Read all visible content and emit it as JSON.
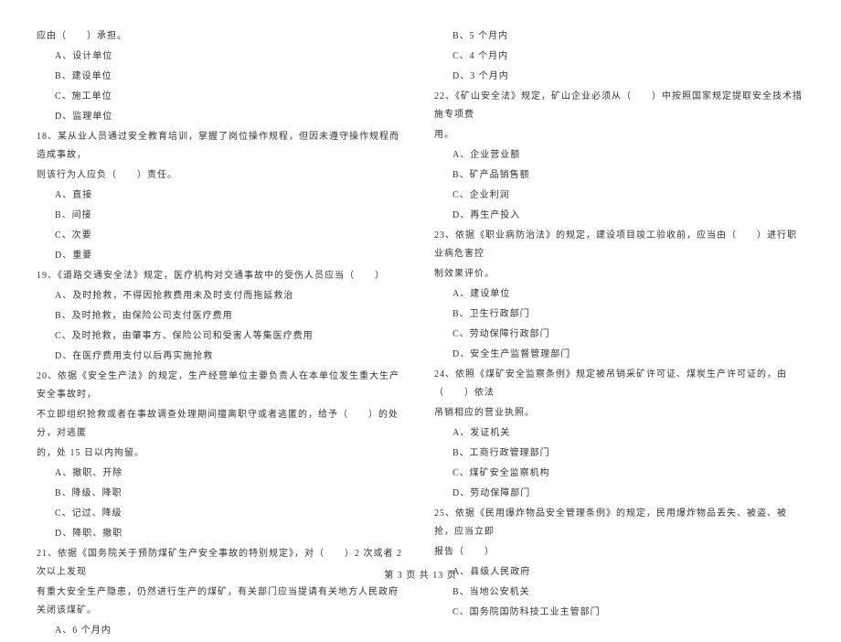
{
  "left": {
    "l0": "应由（　　）承担。",
    "q17": {
      "a": "A、设计单位",
      "b": "B、建设单位",
      "c": "C、施工单位",
      "d": "D、监理单位"
    },
    "q18": {
      "stem1": "18、某从业人员通过安全教育培训，掌握了岗位操作规程，但因未遵守操作规程而造成事故，",
      "stem2": "则该行为人应负（　　）责任。",
      "a": "A、直接",
      "b": "B、间接",
      "c": "C、次要",
      "d": "D、重要"
    },
    "q19": {
      "stem": "19、《道路交通安全法》规定，医疗机构对交通事故中的受伤人员应当（　　）",
      "a": "A、及时抢救，不得因抢救费用未及时支付而拖延救治",
      "b": "B、及时抢救，由保险公司支付医疗费用",
      "c": "C、及时抢救，由肇事方、保险公司和受害人等集医疗费用",
      "d": "D、在医疗费用支付以后再实施抢救"
    },
    "q20": {
      "stem1": "20、依据《安全生产法》的规定，生产经营单位主要负责人在本单位发生重大生产安全事故时，",
      "stem2": "不立即组织抢救或者在事故调查处理期间擅离职守或者逃匿的，给予（　　）的处分，对逃匿",
      "stem3": "的，处 15 日以内拘留。",
      "a": "A、撤职、开除",
      "b": "B、降级、降职",
      "c": "C、记过、降级",
      "d": "D、降职、撤职"
    },
    "q21": {
      "stem1": "21、依据《国务院关于预防煤矿生产安全事故的特别规定》，对（　　）2 次或者 2 次以上发现",
      "stem2": "有重大安全生产隐患，仍然进行生产的煤矿，有关部门应当提请有关地方人民政府关闭该煤矿。",
      "a": "A、6 个月内"
    }
  },
  "right": {
    "q21r": {
      "b": "B、5 个月内",
      "c": "C、4 个月内",
      "d": "D、3 个月内"
    },
    "q22": {
      "stem1": "22、《矿山安全法》规定，矿山企业必须从（　　）中按照国家规定提取安全技术措施专项费",
      "stem2": "用。",
      "a": "A、企业营业额",
      "b": "B、矿产品销售额",
      "c": "C、企业利润",
      "d": "D、再生产投入"
    },
    "q23": {
      "stem1": "23、依据《职业病防治法》的规定，建设项目竣工验收前，应当由（　　）进行职业病危害控",
      "stem2": "制效果评价。",
      "a": "A、建设单位",
      "b": "B、卫生行政部门",
      "c": "C、劳动保障行政部门",
      "d": "D、安全生产监督管理部门"
    },
    "q24": {
      "stem1": "24、依照《煤矿安全监察条例》规定被吊销采矿许可证、煤炭生产许可证的，由（　　）依法",
      "stem2": "吊销相应的营业执照。",
      "a": "A、发证机关",
      "b": "B、工商行政管理部门",
      "c": "C、煤矿安全监察机构",
      "d": "D、劳动保障部门"
    },
    "q25": {
      "stem1": "25、依据《民用爆炸物品安全管理条例》的规定，民用爆炸物品丢失、被盗、被抢，应当立即",
      "stem2": "报告（　　）",
      "a": "A、县级人民政府",
      "b": "B、当地公安机关",
      "c": "C、国务院国防科技工业主管部门"
    }
  },
  "footer": "第 3 页 共 13 页"
}
